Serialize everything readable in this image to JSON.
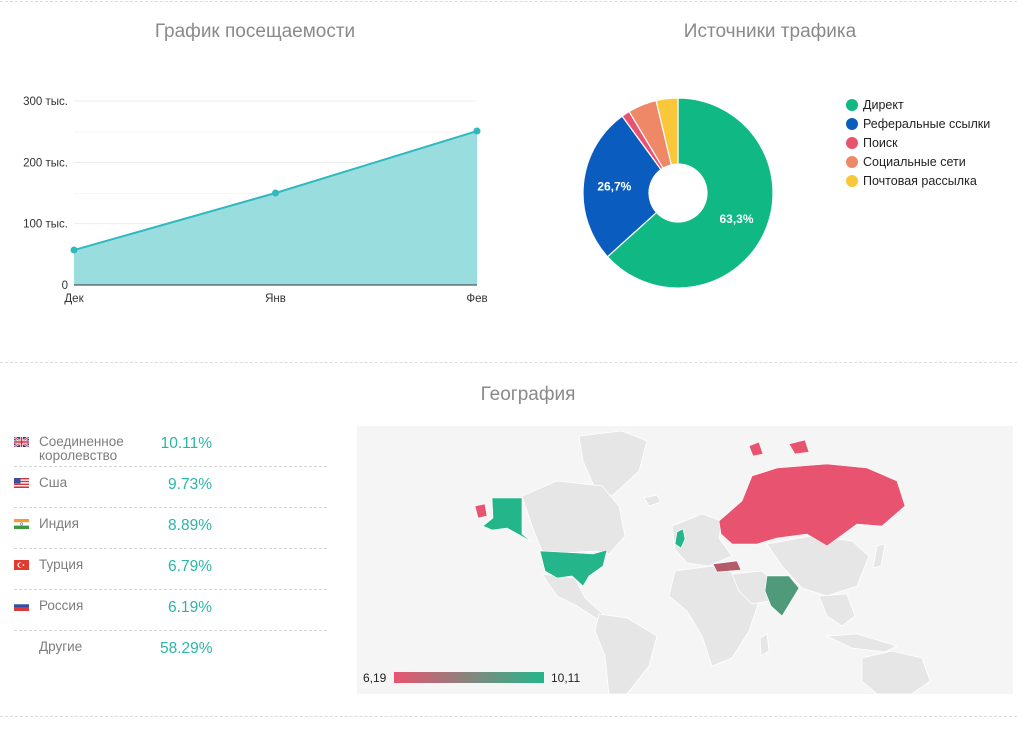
{
  "attendance": {
    "title": "График посещаемости",
    "chart_data": {
      "type": "area",
      "title": "График посещаемости",
      "categories": [
        "Дек",
        "Янв",
        "Фев"
      ],
      "values": [
        57000,
        150000,
        251000
      ],
      "yticks": [
        "0",
        "100 тыс.",
        "200 тыс.",
        "300 тыс."
      ],
      "ytick_values": [
        0,
        100000,
        200000,
        300000
      ],
      "ylim": [
        0,
        300000
      ],
      "grid": true,
      "colors": {
        "line": "#2fb9bf",
        "fill": "#9addde"
      }
    }
  },
  "traffic": {
    "title": "Источники трафика",
    "chart_data": {
      "type": "pie",
      "title": "Источники трафика",
      "labels": [
        "Директ",
        "Реферальные ссылки",
        "Поиск",
        "Социальные сети",
        "Почтовая рассылка"
      ],
      "values": [
        63.3,
        26.7,
        1.4,
        4.9,
        3.7
      ],
      "data_labels": [
        "63,3%",
        "26,7%",
        "",
        "",
        ""
      ],
      "colors": [
        "#10b884",
        "#0b5cbf",
        "#e85470",
        "#ef8866",
        "#fac63a"
      ],
      "legend_position": "right",
      "donut": true
    }
  },
  "geography": {
    "title": "География",
    "countries": [
      {
        "name": "Соединенное королевство",
        "pct": "10.11%",
        "flag": "uk-flag-icon"
      },
      {
        "name": "Сша",
        "pct": "9.73%",
        "flag": "us-flag-icon"
      },
      {
        "name": "Индия",
        "pct": "8.89%",
        "flag": "india-flag-icon"
      },
      {
        "name": "Турция",
        "pct": "6.79%",
        "flag": "turkey-flag-icon"
      },
      {
        "name": "Россия",
        "pct": "6.19%",
        "flag": "russia-flag-icon"
      },
      {
        "name": "Другие",
        "pct": "58.29%",
        "flag": ""
      }
    ],
    "map": {
      "scale_min": "6,19",
      "scale_max": "10,11",
      "color_min": "#e85470",
      "color_max": "#24b58a",
      "land_color": "#e6e6e6"
    }
  }
}
